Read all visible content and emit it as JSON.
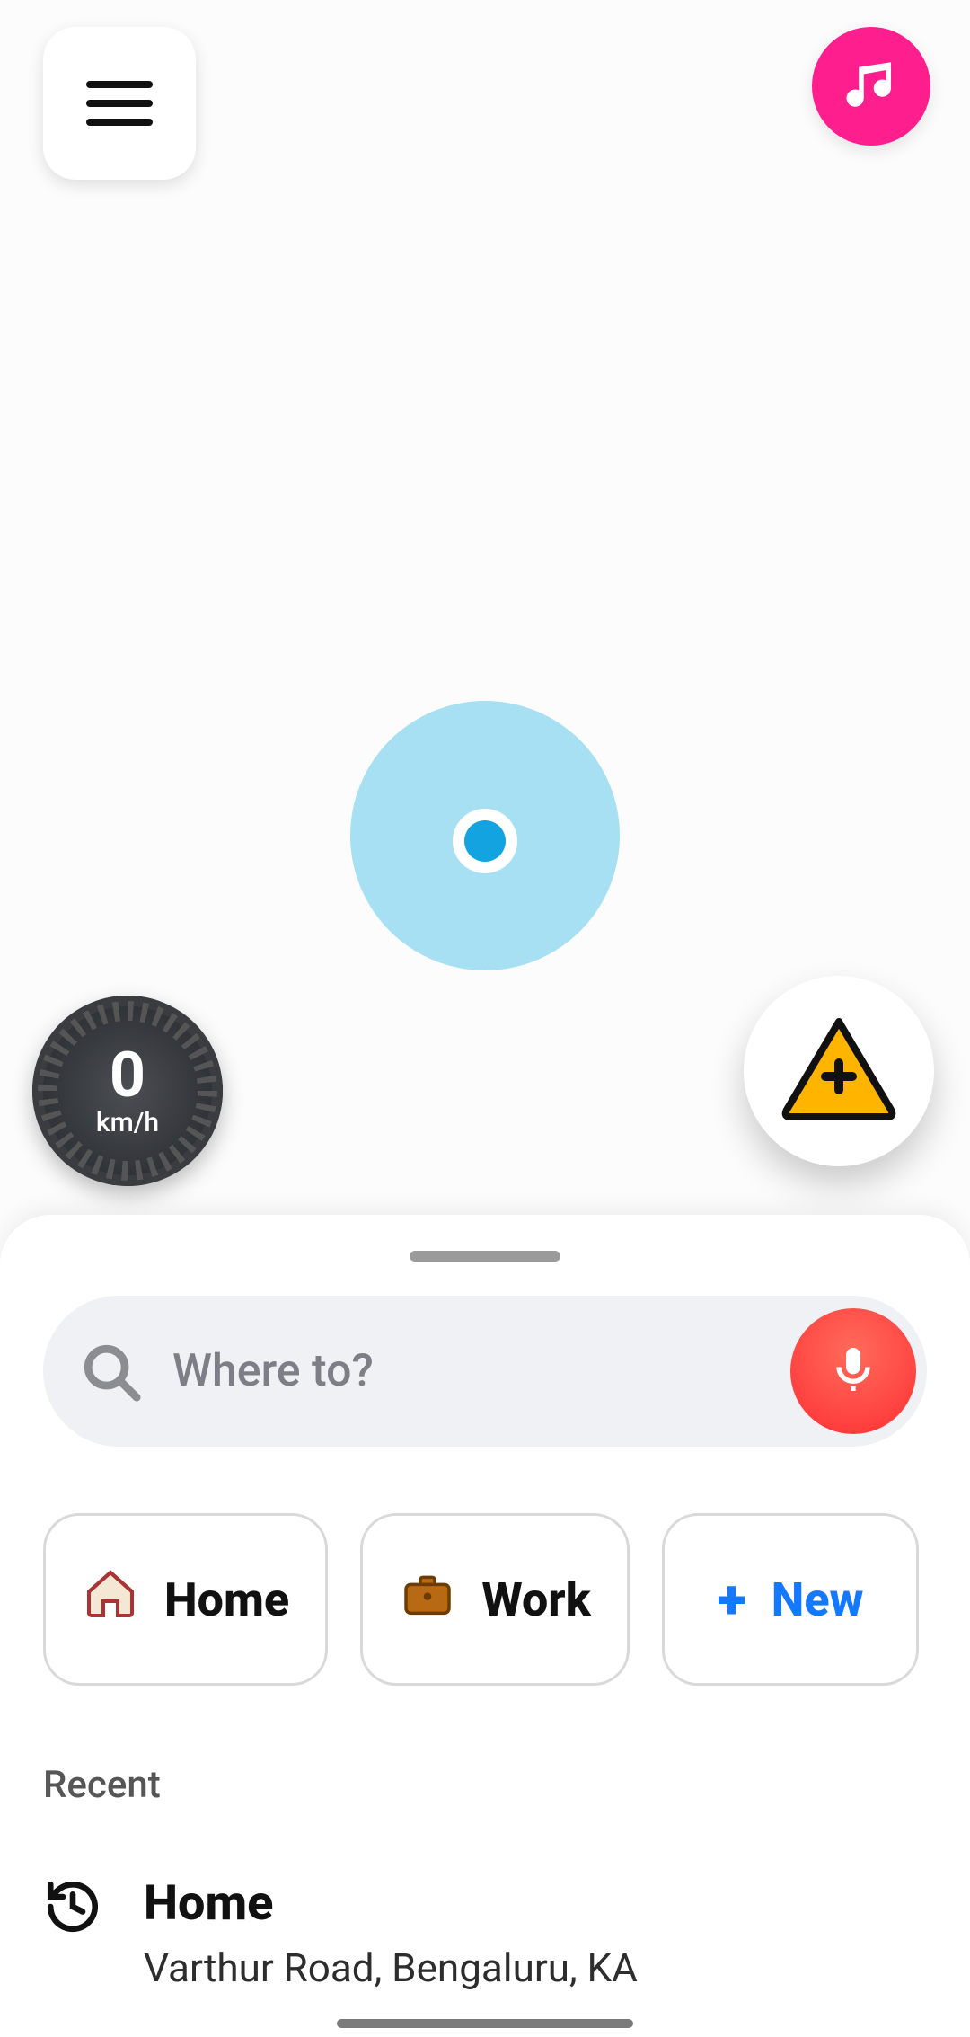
{
  "colors": {
    "accent_pink": "#ff1e8e",
    "accent_red": "#ff3b3b",
    "accent_blue": "#1479ff",
    "speedometer_bg": "#2c2f33"
  },
  "map": {
    "speed_value": "0",
    "speed_unit": "km/h"
  },
  "icons": {
    "menu": "hamburger-icon",
    "music": "music-note-icon",
    "report": "warning-plus-icon",
    "search": "search-icon",
    "mic": "microphone-icon",
    "history": "history-icon"
  },
  "search": {
    "placeholder": "Where to?"
  },
  "shortcuts": [
    {
      "id": "home",
      "label": "Home",
      "icon": "home-icon"
    },
    {
      "id": "work",
      "label": "Work",
      "icon": "briefcase-icon"
    },
    {
      "id": "new",
      "label": "New",
      "icon": "plus-icon"
    }
  ],
  "recent_section_label": "Recent",
  "recent_items": [
    {
      "title": "Home",
      "subtitle": "Varthur Road, Bengaluru, KA",
      "icon": "history-icon"
    }
  ]
}
